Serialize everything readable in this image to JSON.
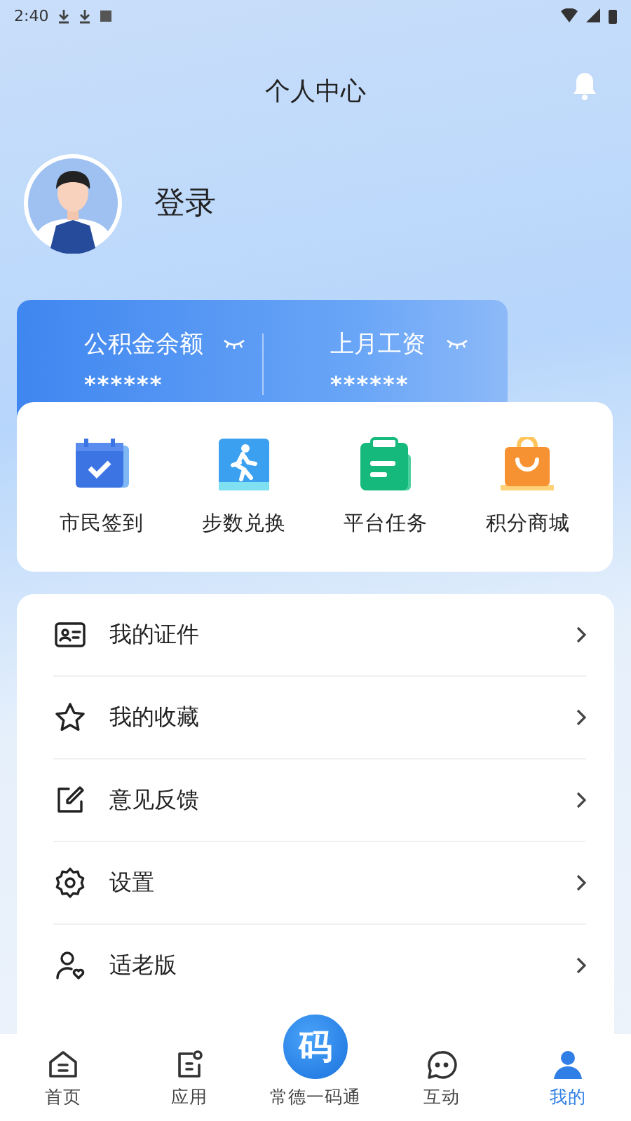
{
  "status_bar": {
    "time": "2:40"
  },
  "header": {
    "title": "个人中心"
  },
  "profile": {
    "login_label": "登录"
  },
  "account_card": {
    "items": [
      {
        "label": "公积金余额",
        "value": "******",
        "hidden": true
      },
      {
        "label": "上月工资",
        "value": "******",
        "hidden": true
      }
    ]
  },
  "quick_actions": [
    {
      "label": "市民签到",
      "kind": "calendar"
    },
    {
      "label": "步数兑换",
      "kind": "walk"
    },
    {
      "label": "平台任务",
      "kind": "clipboard"
    },
    {
      "label": "积分商城",
      "kind": "bag"
    }
  ],
  "menu": [
    {
      "label": "我的证件",
      "kind": "id"
    },
    {
      "label": "我的收藏",
      "kind": "star"
    },
    {
      "label": "意见反馈",
      "kind": "edit"
    },
    {
      "label": "设置",
      "kind": "settings"
    },
    {
      "label": "适老版",
      "kind": "elder"
    }
  ],
  "bottom_nav": {
    "center_badge": "码",
    "items": [
      {
        "label": "首页",
        "kind": "home",
        "selected": false
      },
      {
        "label": "应用",
        "kind": "apps",
        "selected": false
      },
      {
        "label": "常德一码通",
        "kind": "code",
        "selected": false
      },
      {
        "label": "互动",
        "kind": "chat",
        "selected": false
      },
      {
        "label": "我的",
        "kind": "me",
        "selected": true
      }
    ]
  }
}
